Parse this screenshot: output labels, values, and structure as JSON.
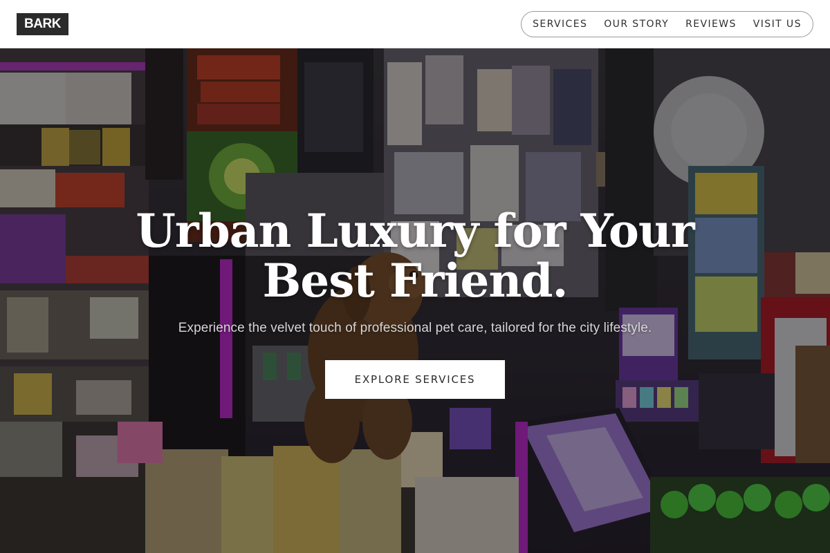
{
  "header": {
    "logo": "BARK",
    "nav": [
      {
        "label": "SERVICES"
      },
      {
        "label": "OUR STORY"
      },
      {
        "label": "REVIEWS"
      },
      {
        "label": "VISIT US"
      }
    ]
  },
  "hero": {
    "title_line1": "Urban Luxury for Your",
    "title_line2": "Best Friend.",
    "subtitle": "Experience the velvet touch of professional pet care, tailored for the city lifestyle.",
    "cta_label": "EXPLORE SERVICES",
    "background_image": "dog sitting among shelves of snacks and magazines in a convenience shop",
    "colors": {
      "header_bg": "#ffffff",
      "logo_bg": "#2b2b2b",
      "accent_magenta": "#c02bd0",
      "button_bg": "#ffffff"
    }
  }
}
